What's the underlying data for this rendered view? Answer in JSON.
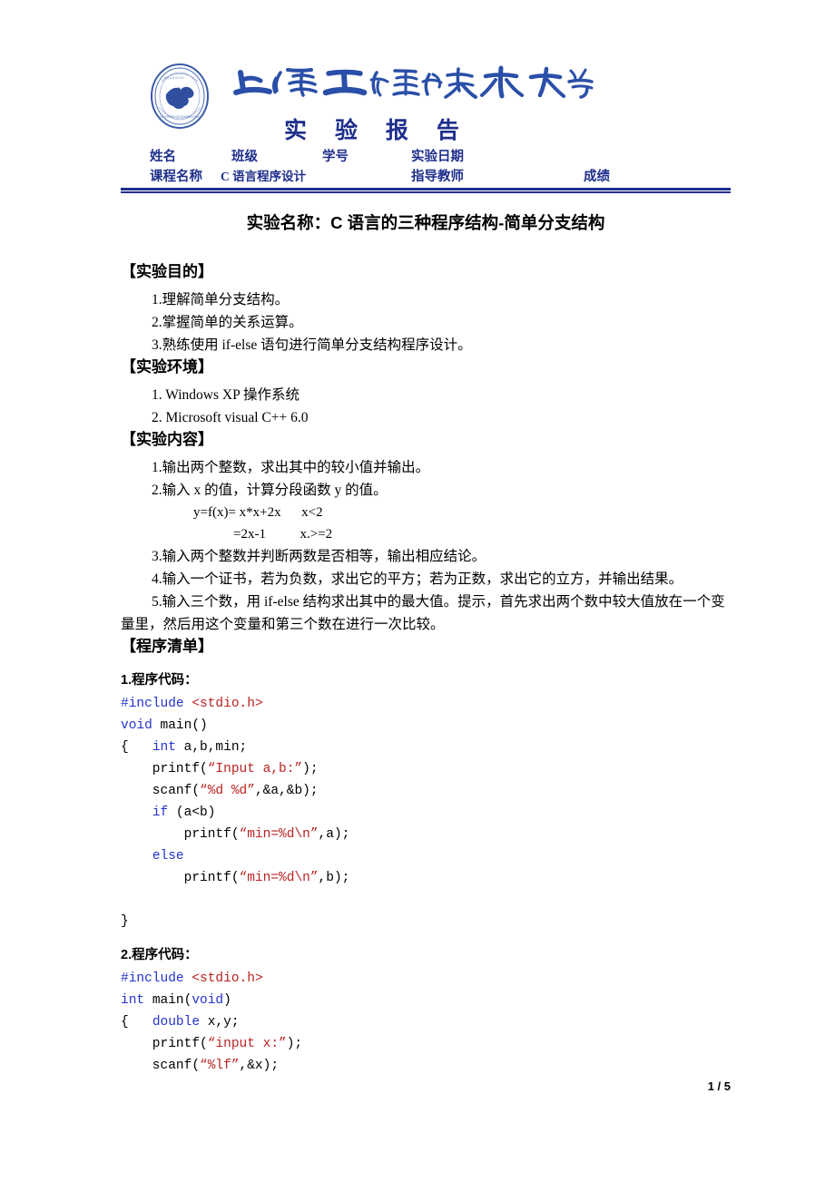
{
  "masthead": {
    "logo_icon": "university-seal-icon",
    "university_name": "上海工程技术大学",
    "report_title": "实  验  报  告"
  },
  "form": {
    "name_label": "姓名",
    "class_label": "班级",
    "student_id_label": "学号",
    "date_label": "实验日期",
    "course_label": "课程名称",
    "course_value": "C 语言程序设计",
    "teacher_label": "指导教师",
    "grade_label": "成绩"
  },
  "experiment_title": "实验名称：C 语言的三种程序结构-简单分支结构",
  "sections": {
    "purpose": {
      "heading": "【实验目的】",
      "items": [
        "1.理解简单分支结构。",
        "2.掌握简单的关系运算。",
        "3.熟练使用 if-else 语句进行简单分支结构程序设计。"
      ]
    },
    "environment": {
      "heading": "【实验环境】",
      "items": [
        "1. Windows XP 操作系统",
        "2. Microsoft visual C++ 6.0"
      ]
    },
    "content": {
      "heading": "【实验内容】",
      "item1": "1.输出两个整数，求出其中的较小值并输出。",
      "item2": "2.输入 x 的值，计算分段函数 y 的值。",
      "formula_line1": "y=f(x)= x*x+2x      x<2",
      "formula_line2": "=2x-1          x.>=2",
      "item3": "3.输入两个整数并判断两数是否相等，输出相应结论。",
      "item4": "4.输入一个证书，若为负数，求出它的平方；若为正数，求出它的立方，并输出结果。",
      "item5": "5.输入三个数，用 if-else 结构求出其中的最大值。提示，首先求出两个数中较大值放在一个变量里，然后用这个变量和第三个数在进行一次比较。"
    },
    "listing": {
      "heading": "【程序清单】",
      "code1_heading": "1.程序代码：",
      "code2_heading": "2.程序代码："
    }
  },
  "code1": {
    "lines": [
      [
        {
          "t": "#include ",
          "c": "pre-dir"
        },
        {
          "t": "<stdio.h>",
          "c": "hdr"
        }
      ],
      [
        {
          "t": "void ",
          "c": "kw"
        },
        {
          "t": "main()",
          "c": ""
        }
      ],
      [
        {
          "t": "{   ",
          "c": ""
        },
        {
          "t": "int ",
          "c": "kw"
        },
        {
          "t": "a,b,min;",
          "c": ""
        }
      ],
      [
        {
          "t": "    printf(",
          "c": ""
        },
        {
          "t": "“Input a,b:”",
          "c": "str"
        },
        {
          "t": ");",
          "c": ""
        }
      ],
      [
        {
          "t": "    scanf(",
          "c": ""
        },
        {
          "t": "“%d %d”",
          "c": "str"
        },
        {
          "t": ",&a,&b);",
          "c": ""
        }
      ],
      [
        {
          "t": "    ",
          "c": ""
        },
        {
          "t": "if ",
          "c": "kw"
        },
        {
          "t": "(a<b)",
          "c": ""
        }
      ],
      [
        {
          "t": "        printf(",
          "c": ""
        },
        {
          "t": "“min=%d\\n”",
          "c": "str"
        },
        {
          "t": ",a);",
          "c": ""
        }
      ],
      [
        {
          "t": "    ",
          "c": ""
        },
        {
          "t": "else",
          "c": "kw"
        }
      ],
      [
        {
          "t": "        printf(",
          "c": ""
        },
        {
          "t": "“min=%d\\n”",
          "c": "str"
        },
        {
          "t": ",b);",
          "c": ""
        }
      ],
      [
        {
          "t": "",
          "c": ""
        }
      ],
      [
        {
          "t": "}",
          "c": ""
        }
      ]
    ]
  },
  "code2": {
    "lines": [
      [
        {
          "t": "#include ",
          "c": "pre-dir"
        },
        {
          "t": "<stdio.h>",
          "c": "hdr"
        }
      ],
      [
        {
          "t": "int ",
          "c": "kw"
        },
        {
          "t": "main(",
          "c": ""
        },
        {
          "t": "void",
          "c": "kw"
        },
        {
          "t": ")",
          "c": ""
        }
      ],
      [
        {
          "t": "{   ",
          "c": ""
        },
        {
          "t": "double ",
          "c": "kw"
        },
        {
          "t": "x,y;",
          "c": ""
        }
      ],
      [
        {
          "t": "    printf(",
          "c": ""
        },
        {
          "t": "“input x:”",
          "c": "str"
        },
        {
          "t": ");",
          "c": ""
        }
      ],
      [
        {
          "t": "    scanf(",
          "c": ""
        },
        {
          "t": "“%lf”",
          "c": "str"
        },
        {
          "t": ",&x);",
          "c": ""
        }
      ]
    ]
  },
  "footer": {
    "page_number": "1 / 5"
  },
  "colors": {
    "accent_navy": "#1f2f8c",
    "code_keyword": "#2233cc",
    "code_string": "#bb2222"
  }
}
